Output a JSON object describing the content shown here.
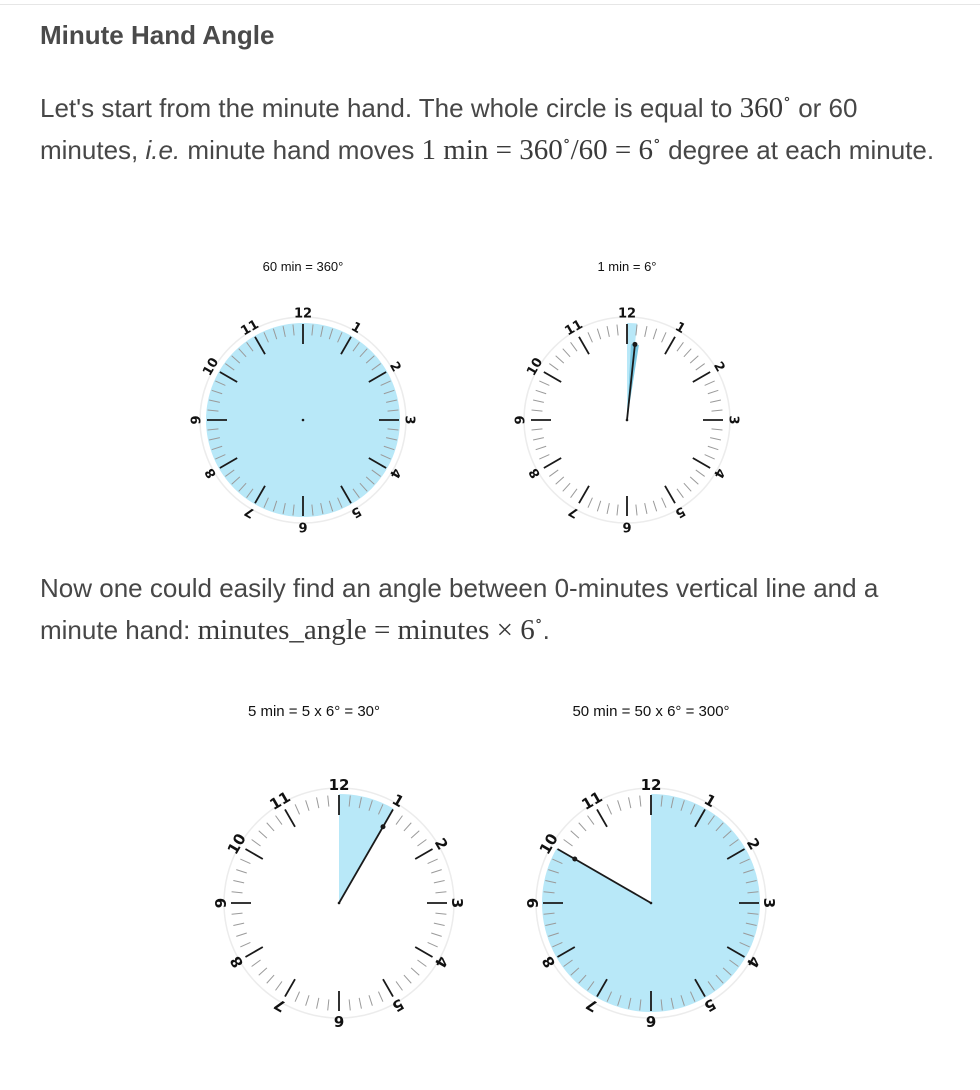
{
  "section": {
    "title": "Minute Hand Angle"
  },
  "paragraph1": {
    "part1": "Let's start from the minute hand. The whole circle is equal to ",
    "math1": "360",
    "part2": " or 60 minutes, ",
    "ie": "i.e.",
    "part3": " minute hand moves ",
    "math2a": "1 min = 360",
    "math2b": "/60 = 6",
    "part4": " degree at each minute."
  },
  "paragraph2": {
    "part1": "Now one could easily find an angle between 0-minutes vertical line and a minute hand: ",
    "math1": "minutes_angle = minutes × 6",
    "part2": "."
  },
  "colors": {
    "wedge": "#b8e8f8",
    "hand_blue": "#7cc8e2"
  },
  "clocks": [
    {
      "caption": "60 min = 360°",
      "minutes": 60
    },
    {
      "caption": "1 min = 6°",
      "minutes": 1
    },
    {
      "caption": "5 min = 5 x 6° = 30°",
      "minutes": 5
    },
    {
      "caption": "50 min = 50 x 6° = 300°",
      "minutes": 50
    }
  ],
  "clock_numbers": [
    "12",
    "1",
    "2",
    "3",
    "4",
    "5",
    "6",
    "7",
    "8",
    "9",
    "10",
    "11"
  ]
}
